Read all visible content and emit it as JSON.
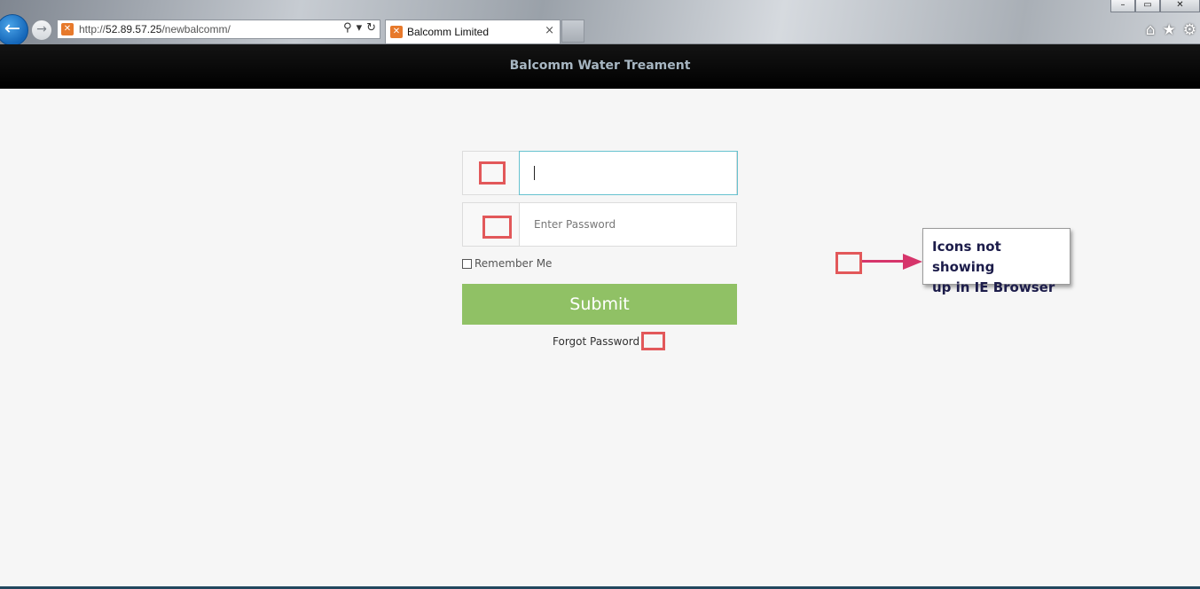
{
  "browser": {
    "url_prefix": "http://",
    "url_host": "52.89.57.25",
    "url_path": "/newbalcomm/",
    "tab_title": "Balcomm Limited",
    "tab_close": "×",
    "back_icon": "back-arrow-icon",
    "forward_icon": "forward-arrow-icon",
    "window_buttons": {
      "minimize": "–",
      "maximize": "▭",
      "close": "✕"
    },
    "right_icons": {
      "home": "⌂",
      "favorites": "★",
      "tools": "⚙"
    }
  },
  "header": {
    "title": "Balcomm Water Treament"
  },
  "login": {
    "username_value": "",
    "password_placeholder": "Enter Password",
    "remember_label": "Remember Me",
    "submit_label": "Submit",
    "forgot_label": "Forgot Password"
  },
  "annotation": {
    "text_line1": "Icons not showing",
    "text_line2": "up in IE Browser",
    "highlight_color": "#e2585a",
    "arrow_color": "#d6356b"
  },
  "colors": {
    "submit": "#90c165",
    "header_bg": "#000000",
    "page_bg": "#f6f6f6"
  }
}
